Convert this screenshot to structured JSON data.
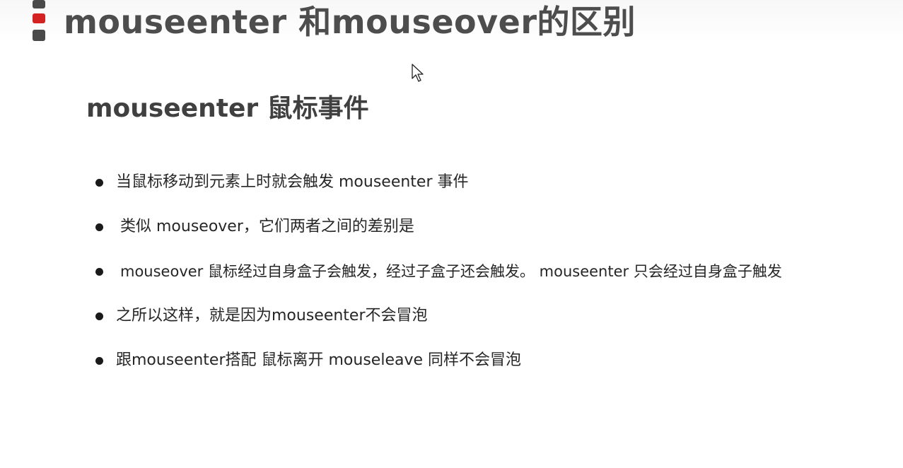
{
  "slide": {
    "title": "mouseenter 和mouseover的区别",
    "subtitle": "mouseenter  鼠标事件",
    "bullets": [
      {
        "text": "当鼠标移动到元素上时就会触发 mouseenter 事件"
      },
      {
        "text": "类似 mouseover，它们两者之间的差别是"
      },
      {
        "text": "mouseover 鼠标经过自身盒子会触发，经过子盒子还会触发。 mouseenter  只会经过自身盒子触发"
      },
      {
        "text": "之所以这样，就是因为mouseenter不会冒泡"
      },
      {
        "text": "跟mouseenter搭配 鼠标离开 mouseleave  同样不会冒泡"
      }
    ]
  },
  "colors": {
    "title_text": "#4d4d4d",
    "accent_red": "#d42222",
    "bar_gray": "#4a4a4a",
    "body_text": "#262626"
  },
  "icons": {
    "cursor": "mouse-pointer-icon",
    "bullet": "bullet-dot-icon"
  }
}
